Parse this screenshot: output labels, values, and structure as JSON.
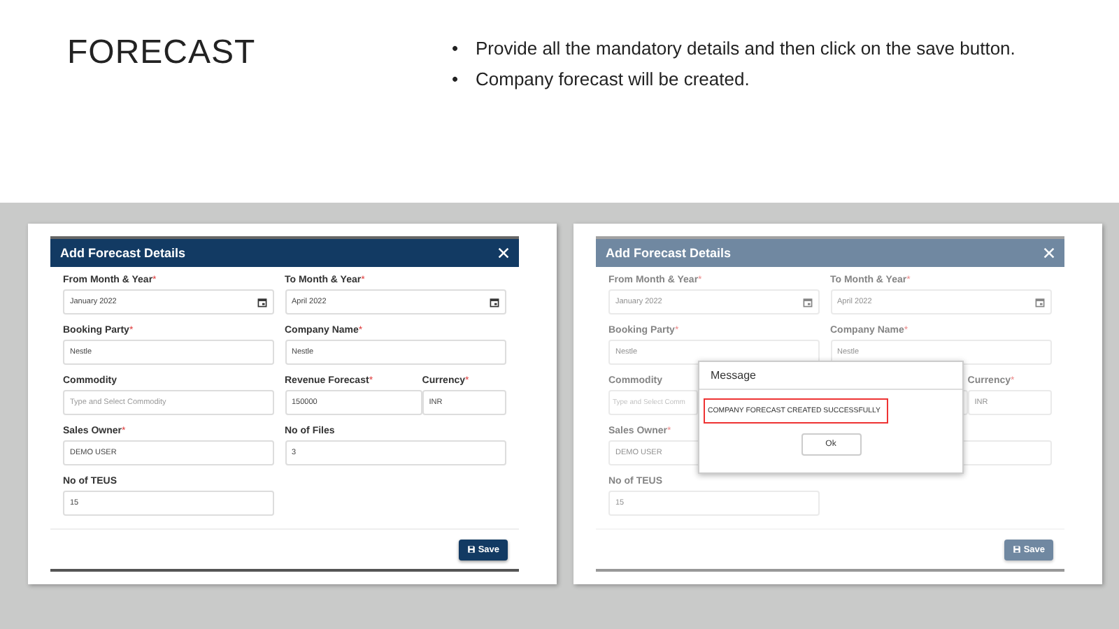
{
  "slide": {
    "title": "FORECAST",
    "bullets": [
      {
        "mark": "•",
        "text": "Provide all the mandatory details and then click on the save button."
      },
      {
        "mark": "•",
        "text": "Company forecast will be created."
      }
    ]
  },
  "screens": [
    {
      "dimmed": false,
      "title": "Add Forecast Details",
      "save": "Save",
      "rows": [
        [
          {
            "kind": "date",
            "label": "From Month & Year",
            "asterisk": "*",
            "value": "January 2022"
          },
          {
            "kind": "date",
            "label": "To Month & Year",
            "asterisk": "*",
            "value": "April 2022"
          }
        ],
        [
          {
            "kind": "text",
            "label": "Booking Party",
            "asterisk": "*",
            "value": "Nestle"
          },
          {
            "kind": "text",
            "label": "Company Name",
            "asterisk": "*",
            "value": "Nestle"
          }
        ],
        [
          {
            "kind": "text",
            "label": "Commodity",
            "placeholder": "Type and Select Commodity"
          },
          {
            "kind": "text",
            "label": "Revenue Forecast",
            "asterisk": "*",
            "value": "150000"
          },
          {
            "kind": "text",
            "label": "Currency",
            "asterisk": "*",
            "value": "INR"
          }
        ],
        [
          {
            "kind": "text",
            "label": "Sales Owner",
            "asterisk": "*",
            "value": "DEMO USER"
          },
          {
            "kind": "text",
            "label": "No of Files",
            "value": "3"
          }
        ],
        [
          {
            "kind": "text",
            "label": "No of TEUS",
            "value": "15"
          }
        ]
      ]
    },
    {
      "dimmed": true,
      "title": "Add Forecast Details",
      "save": "Save",
      "rows": [
        [
          {
            "kind": "date",
            "label": "From Month & Year",
            "asterisk": "*",
            "value": "January 2022"
          },
          {
            "kind": "date",
            "label": "To Month & Year",
            "asterisk": "*",
            "value": "April 2022"
          }
        ],
        [
          {
            "kind": "text",
            "label": "Booking Party",
            "asterisk": "*",
            "value": "Nestle"
          },
          {
            "kind": "text",
            "label": "Company Name",
            "asterisk": "*",
            "value": "Nestle"
          }
        ],
        [
          {
            "kind": "text",
            "label": "Commodity",
            "placeholder": "Type and Select Comm"
          },
          {
            "kind": "text"
          },
          {
            "kind": "text",
            "label": "Currency",
            "asterisk": "*",
            "value": "INR"
          }
        ],
        [
          {
            "kind": "text",
            "label": "Sales Owner",
            "asterisk": "*",
            "value": "DEMO USER"
          },
          {
            "kind": "text"
          }
        ],
        [
          {
            "kind": "text",
            "label": "No of TEUS",
            "value": "15"
          }
        ]
      ],
      "message": {
        "title": "Message",
        "text": "COMPANY FORECAST CREATED SUCCESSFULLY",
        "button": "Ok"
      }
    }
  ]
}
